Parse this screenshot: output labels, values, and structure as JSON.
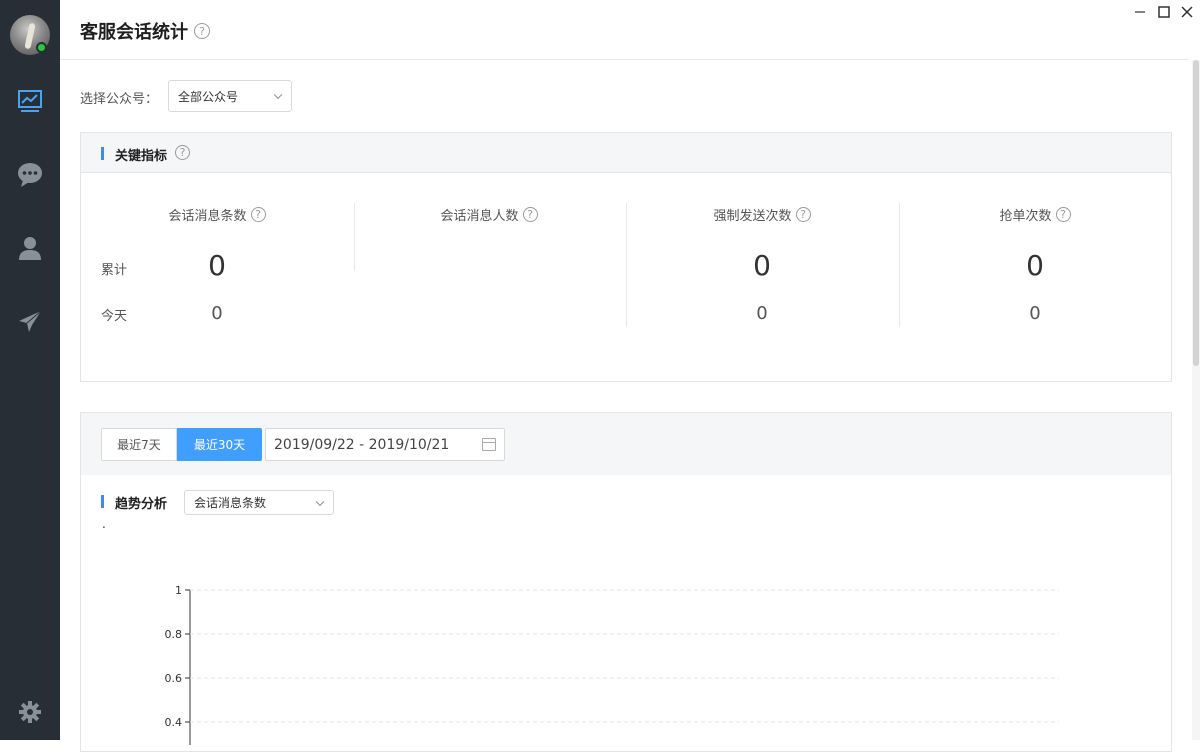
{
  "page": {
    "title": "客服会话统计"
  },
  "sidebar": {
    "icons": [
      "monitor-chart-icon",
      "chat-bubble-icon",
      "user-icon",
      "paper-plane-icon",
      "gear-icon"
    ]
  },
  "window_controls": [
    "minimize",
    "maximize",
    "close"
  ],
  "account_select": {
    "label": "选择公众号：",
    "value": "全部公众号"
  },
  "key_metrics": {
    "title": "关键指标",
    "row_labels": {
      "total": "累计",
      "today": "今天"
    },
    "columns": [
      {
        "label": "会话消息条数",
        "total": "0",
        "today": "0"
      },
      {
        "label": "会话消息人数",
        "total": "",
        "today": ""
      },
      {
        "label": "强制发送次数",
        "total": "0",
        "today": "0"
      },
      {
        "label": "抢单次数",
        "total": "0",
        "today": "0"
      }
    ]
  },
  "trend": {
    "ranges": [
      {
        "label": "最近7天",
        "active": false
      },
      {
        "label": "最近30天",
        "active": true
      }
    ],
    "date_range": "2019/09/22 - 2019/10/21",
    "title": "趋势分析",
    "metric_select": "会话消息条数",
    "dot": "."
  },
  "colors": {
    "sidebar": "#282e36",
    "accent": "#409eff",
    "online": "#27c93f"
  },
  "chart_data": {
    "type": "line",
    "x": [],
    "series": [
      {
        "values": []
      }
    ],
    "ylim": [
      0,
      1
    ],
    "yticks": [
      "1",
      "0.8",
      "0.6",
      "0.4"
    ],
    "grid": true,
    "title": "",
    "xlabel": "",
    "ylabel": ""
  }
}
